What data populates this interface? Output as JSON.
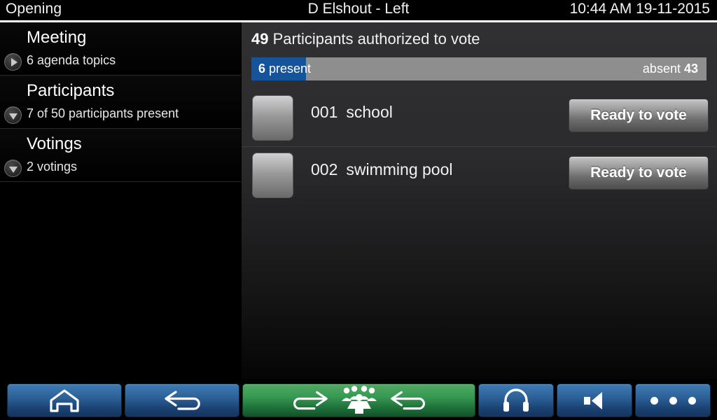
{
  "titlebar": {
    "left": "Opening",
    "center": "D Elshout - Left",
    "right": "10:44 AM 19-11-2015"
  },
  "sidebar": {
    "items": [
      {
        "title": "Meeting",
        "subtitle": "6 agenda topics",
        "toggle": "play-triangle-right-icon",
        "expanded": false
      },
      {
        "title": "Participants",
        "subtitle": "7 of 50 participants present",
        "toggle": "triangle-down-icon",
        "expanded": true
      },
      {
        "title": "Votings",
        "subtitle": "2 votings",
        "toggle": "triangle-down-icon",
        "expanded": true
      }
    ]
  },
  "panel": {
    "header_count": "49",
    "header_text": " Participants authorized to vote",
    "progress": {
      "present_count": "6",
      "present_label": " present",
      "absent_label": "absent ",
      "absent_count": "43",
      "present_percent": 12,
      "fill_color": "#15539b",
      "track_color": "#8e8e8e"
    },
    "votings": [
      {
        "index": "001",
        "name": "school",
        "button": "Ready to vote"
      },
      {
        "index": "002",
        "name": "swimming pool",
        "button": "Ready to vote"
      }
    ]
  },
  "toolbar": {
    "buttons": [
      {
        "name": "home-button",
        "icon": "home-icon",
        "color": "#2d6298"
      },
      {
        "name": "back-button",
        "icon": "back-arrow-icon",
        "color": "#2d6298"
      },
      {
        "name": "center-button",
        "icon": "delegate-group-icon",
        "color": "#379a53"
      },
      {
        "name": "audio-button",
        "icon": "headphones-icon",
        "color": "#2d6298"
      },
      {
        "name": "volume-button",
        "icon": "speaker-icon",
        "color": "#2d6298"
      },
      {
        "name": "more-button",
        "icon": "ellipsis-icon",
        "color": "#2d6298"
      }
    ]
  }
}
